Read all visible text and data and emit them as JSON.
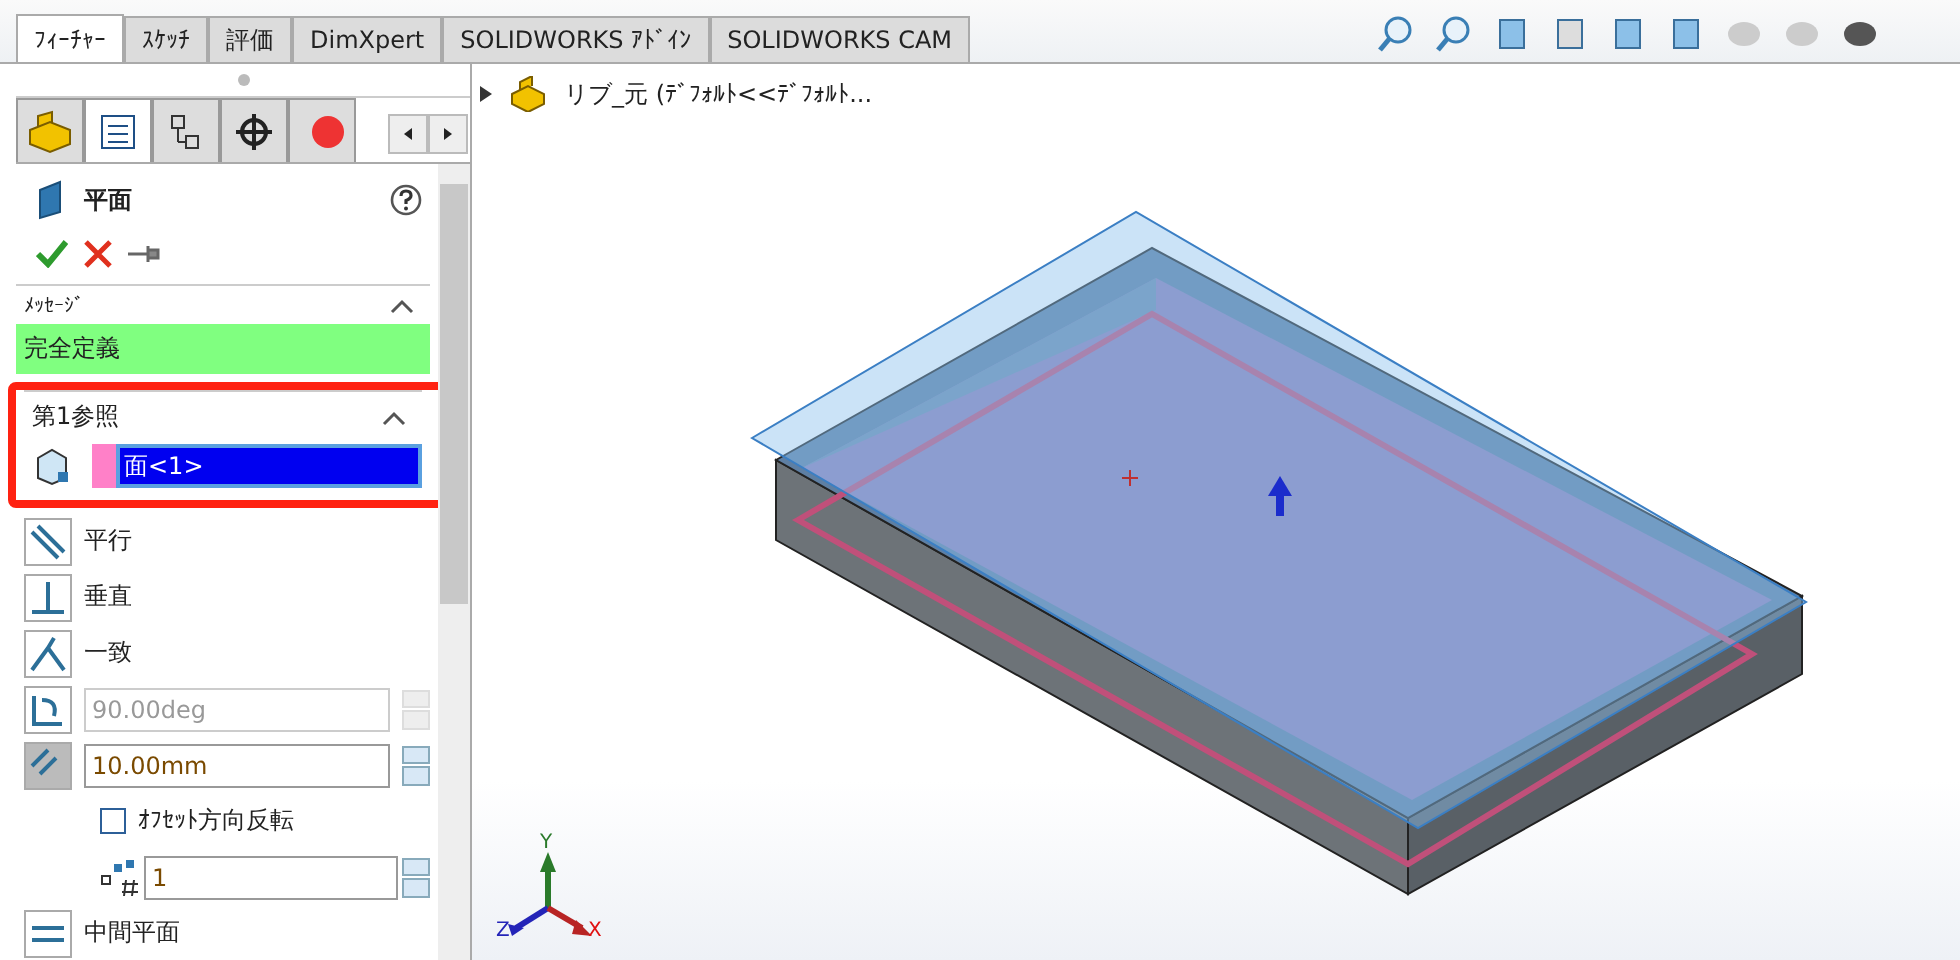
{
  "tabs": [
    {
      "label": "ﾌｨｰﾁｬｰ",
      "selected": true
    },
    {
      "label": "ｽｹｯﾁ",
      "selected": false
    },
    {
      "label": "評価",
      "selected": false
    },
    {
      "label": "DimXpert",
      "selected": false
    },
    {
      "label": "SOLIDWORKS ｱﾄﾞｲﾝ",
      "selected": false
    },
    {
      "label": "SOLIDWORKS CAM",
      "selected": false
    }
  ],
  "panel_tabs": [
    {
      "selected": false
    },
    {
      "selected": true
    },
    {
      "selected": false
    },
    {
      "selected": false
    },
    {
      "selected": false
    }
  ],
  "property_manager": {
    "title": "平面",
    "message_section": {
      "title": "ﾒｯｾｰｼﾞ",
      "expanded": true,
      "message": "完全定義"
    },
    "reference_section": {
      "title": "第1参照",
      "expanded": true,
      "highlighted": true,
      "value": "面<1>"
    },
    "options": [
      {
        "kind": "constraint",
        "label": "平行"
      },
      {
        "kind": "constraint",
        "label": "垂直"
      },
      {
        "kind": "constraint",
        "label": "一致"
      },
      {
        "kind": "spin",
        "value": "90.00deg",
        "disabled": true
      },
      {
        "kind": "spin",
        "value": "10.00mm",
        "disabled": false
      },
      {
        "kind": "checkbox",
        "label": "ｵﾌｾｯﾄ方向反転",
        "checked": false
      },
      {
        "kind": "count",
        "value": "1",
        "disabled": false
      },
      {
        "kind": "constraint",
        "label": "中間平面"
      }
    ]
  },
  "tree": {
    "label": "リブ_元 (ﾃﾞﾌｫﾙﾄ<<ﾃﾞﾌｫﾙﾄ...",
    "expanded": false
  },
  "triad": {
    "x": "X",
    "y": "Y",
    "z": "Z"
  }
}
